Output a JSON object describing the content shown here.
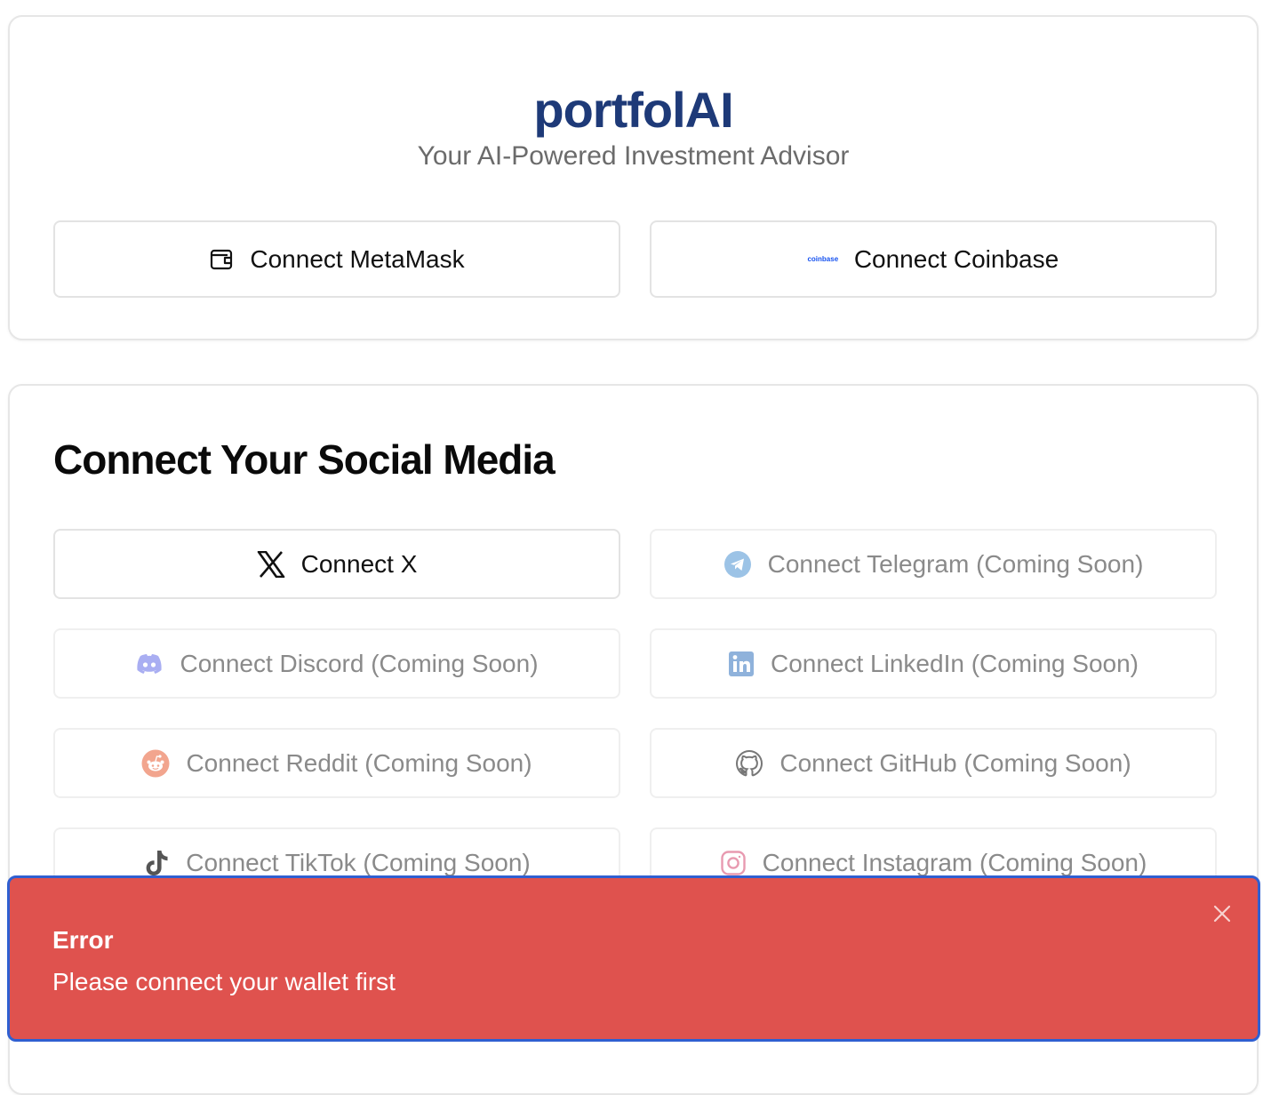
{
  "brand": {
    "name": "portfolAI",
    "tagline": "Your AI-Powered Investment Advisor"
  },
  "wallets": {
    "metamask_label": "Connect MetaMask",
    "coinbase_label": "Connect Coinbase",
    "coinbase_logo_text": "coinbase"
  },
  "social": {
    "title": "Connect Your Social Media",
    "x_label": "Connect X",
    "telegram_label": "Connect Telegram (Coming Soon)",
    "discord_label": "Connect Discord (Coming Soon)",
    "linkedin_label": "Connect LinkedIn (Coming Soon)",
    "reddit_label": "Connect Reddit (Coming Soon)",
    "github_label": "Connect GitHub (Coming Soon)",
    "tiktok_label": "Connect TikTok (Coming Soon)",
    "instagram_label": "Connect Instagram (Coming Soon)"
  },
  "toast": {
    "title": "Error",
    "message": "Please connect your wallet first"
  },
  "colors": {
    "brand": "#1e3a78",
    "toast_bg": "#df524e",
    "toast_border": "#2f5fd1",
    "telegram": "#9cc3e6",
    "discord": "#a9aef2",
    "linkedin": "#8fb2db",
    "reddit": "#f2a58e",
    "instagram": "#e89ab0"
  }
}
